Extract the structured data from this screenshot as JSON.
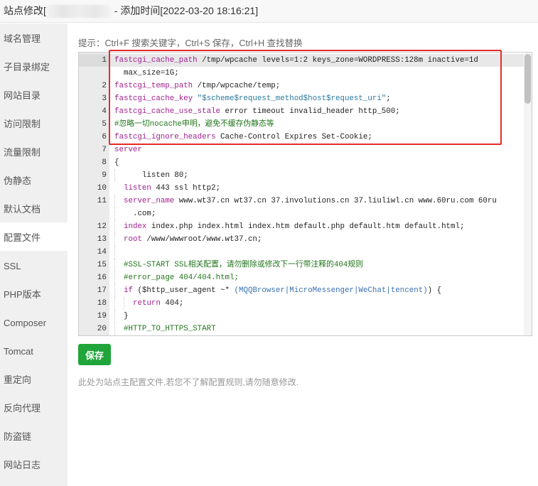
{
  "window": {
    "title_prefix": "站点修改[",
    "title_suffix": " - 添加时间[2022-03-20 18:16:21]"
  },
  "sidebar": {
    "active": 7,
    "items": [
      {
        "label": "域名管理"
      },
      {
        "label": "子目录绑定"
      },
      {
        "label": "网站目录"
      },
      {
        "label": "访问限制"
      },
      {
        "label": "流量限制"
      },
      {
        "label": "伪静态"
      },
      {
        "label": "默认文档"
      },
      {
        "label": "配置文件"
      },
      {
        "label": "SSL"
      },
      {
        "label": "PHP版本"
      },
      {
        "label": "Composer"
      },
      {
        "label": "Tomcat"
      },
      {
        "label": "重定向"
      },
      {
        "label": "反向代理"
      },
      {
        "label": "防盗链"
      },
      {
        "label": "网站日志"
      }
    ]
  },
  "main": {
    "hint": "提示：Ctrl+F 搜索关键字，Ctrl+S 保存，Ctrl+H 查找替换",
    "save_label": "保存",
    "note": "此处为站点主配置文件,若您不了解配置规则,请勿随意修改.",
    "highlight_color": "#e52b2b",
    "accent_color": "#20a53a"
  },
  "editor": {
    "active_line": 1,
    "lines": [
      {
        "n": "1",
        "indent": 0,
        "segs": [
          [
            "kw",
            "fastcgi_cache_path"
          ],
          [
            "",
            "/tmp/wpcache levels=1:2 keys_zone=WORDPRESS:128m inactive=1d"
          ]
        ]
      },
      {
        "n": "",
        "indent": 0,
        "segs": [
          [
            "",
            "  max_size=1G;"
          ]
        ]
      },
      {
        "n": "2",
        "indent": 0,
        "segs": [
          [
            "kw",
            "fastcgi_temp_path"
          ],
          [
            "",
            "/tmp/wpcache/temp;"
          ]
        ]
      },
      {
        "n": "3",
        "indent": 0,
        "segs": [
          [
            "kw",
            "fastcgi_cache_key"
          ],
          [
            "str",
            "\"$scheme$request_method$host$request_uri\""
          ],
          [
            "",
            ";"
          ]
        ]
      },
      {
        "n": "4",
        "indent": 0,
        "segs": [
          [
            "kw",
            "fastcgi_cache_use_stale"
          ],
          [
            "",
            "error timeout invalid_header http_500;"
          ]
        ]
      },
      {
        "n": "5",
        "indent": 0,
        "segs": [
          [
            "cm",
            "#忽略一切nocache申明，避免不缓存伪静态等"
          ]
        ]
      },
      {
        "n": "6",
        "indent": 0,
        "segs": [
          [
            "kw",
            "fastcgi_ignore_headers"
          ],
          [
            "",
            "Cache-Control Expires Set-Cookie;"
          ]
        ]
      },
      {
        "n": "7",
        "indent": 0,
        "segs": [
          [
            "kw",
            "server"
          ]
        ]
      },
      {
        "n": "8",
        "indent": 0,
        "segs": [
          [
            "",
            "{"
          ]
        ]
      },
      {
        "n": "9",
        "indent": 1,
        "segs": [
          [
            "",
            "    listen 80;"
          ]
        ]
      },
      {
        "n": "10",
        "indent": 0,
        "segs": [
          [
            "",
            "  "
          ],
          [
            "kw",
            "listen"
          ],
          [
            "",
            "443 ssl http2;"
          ]
        ]
      },
      {
        "n": "11",
        "indent": 1,
        "segs": [
          [
            "kw",
            "server_name"
          ],
          [
            "",
            "www.wt37.cn wt37.cn 37.involutions.cn 37.liuliwl.cn www.60ru.com 60ru"
          ]
        ]
      },
      {
        "n": "",
        "indent": 1,
        "segs": [
          [
            "",
            "  .com;"
          ]
        ]
      },
      {
        "n": "12",
        "indent": 1,
        "segs": [
          [
            "kw",
            "index"
          ],
          [
            "",
            "index.php index.html index.htm default.php default.htm default.html;"
          ]
        ]
      },
      {
        "n": "13",
        "indent": 1,
        "segs": [
          [
            "kw",
            "root"
          ],
          [
            "",
            "/www/wwwroot/www.wt37.cn;"
          ]
        ]
      },
      {
        "n": "14",
        "indent": 1,
        "segs": []
      },
      {
        "n": "15",
        "indent": 1,
        "segs": [
          [
            "cm",
            "#SSL-START SSL相关配置，请勿删除或修改下一行带注释的404规则"
          ]
        ]
      },
      {
        "n": "16",
        "indent": 1,
        "segs": [
          [
            "cm",
            "#error_page 404/404.html;"
          ]
        ]
      },
      {
        "n": "17",
        "indent": 1,
        "segs": [
          [
            "kw",
            "if"
          ],
          [
            "",
            "($http_user_agent ~* "
          ],
          [
            "rx",
            "(MQQBrowser|MicroMessenger|WeChat|tencent)"
          ],
          [
            "",
            ") {"
          ]
        ]
      },
      {
        "n": "18",
        "indent": 2,
        "segs": [
          [
            "kw",
            "return"
          ],
          [
            "",
            "404;"
          ]
        ]
      },
      {
        "n": "19",
        "indent": 1,
        "segs": [
          [
            "",
            "}"
          ]
        ]
      },
      {
        "n": "20",
        "indent": 1,
        "segs": [
          [
            "cm",
            "#HTTP_TO_HTTPS_START"
          ]
        ]
      }
    ]
  }
}
